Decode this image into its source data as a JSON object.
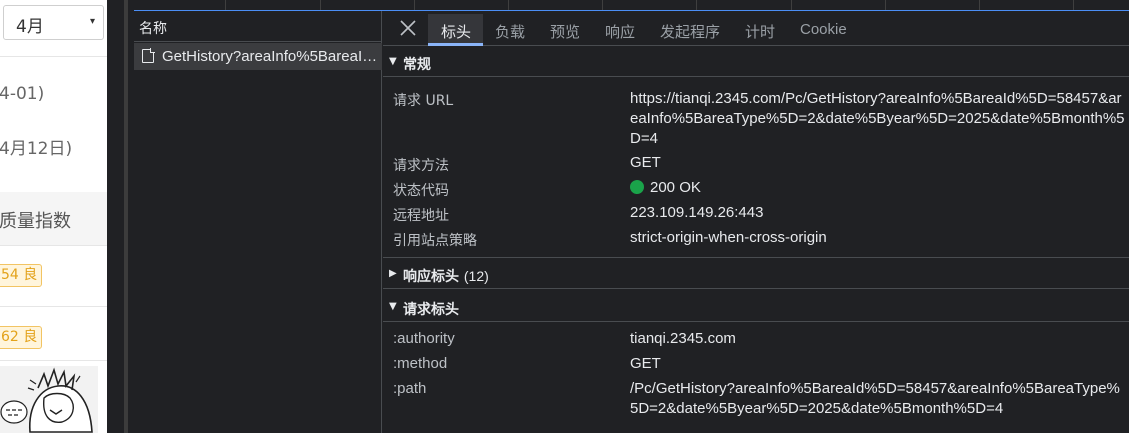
{
  "webpage": {
    "month_select": {
      "value": "4月",
      "arrow": "▾"
    },
    "date_fragment_1": "4-01)",
    "date_fragment_2": "4月12日)",
    "aqi_header": "质量指数",
    "aqi_rows": [
      {
        "label": "54 良"
      },
      {
        "label": "62 良"
      }
    ]
  },
  "devtools": {
    "name_panel": {
      "header": "名称",
      "request": "GetHistory?areaInfo%5BareaId%5D=58457&areaInfo%5BareaType%5D=2&date%5Byear%5D=2025&date%5Bmonth%5D=4"
    },
    "tabs": [
      {
        "label": "标头",
        "active": true
      },
      {
        "label": "负载"
      },
      {
        "label": "预览"
      },
      {
        "label": "响应"
      },
      {
        "label": "发起程序"
      },
      {
        "label": "计时"
      },
      {
        "label": "Cookie"
      }
    ],
    "general": {
      "title": "常规",
      "rows": [
        {
          "key": "请求 URL",
          "value": "https://tianqi.2345.com/Pc/GetHistory?areaInfo%5BareaId%5D=58457&areaInfo%5BareaType%5D=2&date%5Byear%5D=2025&date%5Bmonth%5D=4"
        },
        {
          "key": "请求方法",
          "value": "GET"
        },
        {
          "key": "状态代码",
          "value": "200 OK"
        },
        {
          "key": "远程地址",
          "value": "223.109.149.26:443"
        },
        {
          "key": "引用站点策略",
          "value": "strict-origin-when-cross-origin"
        }
      ]
    },
    "response_headers": {
      "title": "响应标头",
      "count": "(12)"
    },
    "request_headers": {
      "title": "请求标头",
      "rows": [
        {
          "key": ":authority",
          "value": "tianqi.2345.com"
        },
        {
          "key": ":method",
          "value": "GET"
        },
        {
          "key": ":path",
          "value": "/Pc/GetHistory?areaInfo%5BareaId%5D=58457&areaInfo%5BareaType%5D=2&date%5Byear%5D=2025&date%5Bmonth%5D=4"
        }
      ]
    },
    "colors": {
      "accent": "#8ab4f8",
      "status_ok": "#1aa34a",
      "panel_bg": "#202124"
    }
  }
}
